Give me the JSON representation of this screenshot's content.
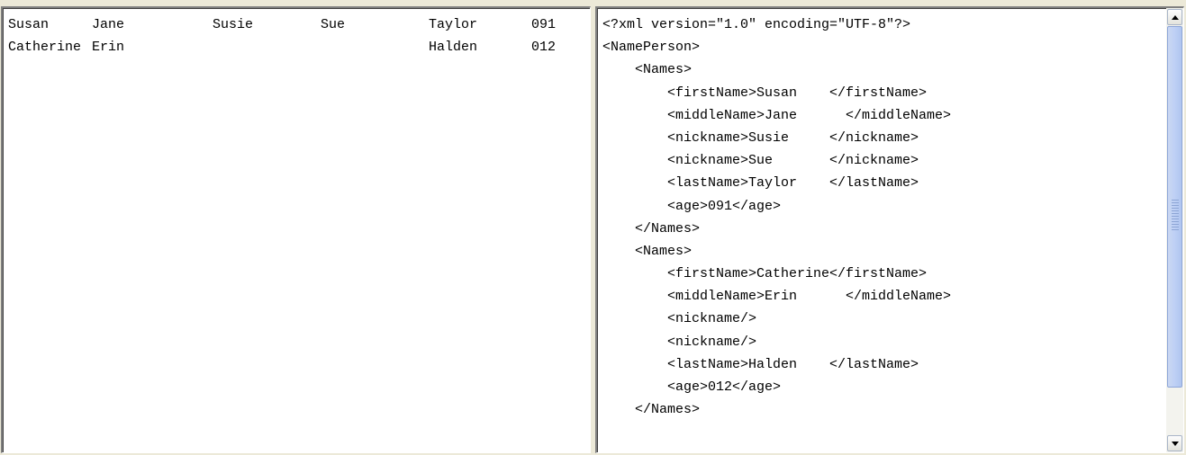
{
  "records": [
    {
      "firstName": "Susan",
      "middleName": "Jane",
      "nickname1": "Susie",
      "nickname2": "Sue",
      "lastName": "Taylor",
      "age": "091"
    },
    {
      "firstName": "Catherine",
      "middleName": "Erin",
      "nickname1": "",
      "nickname2": "",
      "lastName": "Halden",
      "age": "012"
    }
  ],
  "xml_lines": [
    "<?xml version=\"1.0\" encoding=\"UTF-8\"?>",
    "<NamePerson>",
    "    <Names>",
    "        <firstName>Susan    </firstName>",
    "        <middleName>Jane      </middleName>",
    "        <nickname>Susie     </nickname>",
    "        <nickname>Sue       </nickname>",
    "        <lastName>Taylor    </lastName>",
    "        <age>091</age>",
    "    </Names>",
    "    <Names>",
    "        <firstName>Catherine</firstName>",
    "        <middleName>Erin      </middleName>",
    "        <nickname/>",
    "        <nickname/>",
    "        <lastName>Halden    </lastName>",
    "        <age>012</age>",
    "    </Names>"
  ],
  "scrollbar": {
    "up_icon": "scroll-up-arrow",
    "down_icon": "scroll-down-arrow",
    "thumb_color": "#bed0f5",
    "track_color": "#f3f3ee"
  },
  "colors": {
    "window_bg": "#ece9d8",
    "pane_bg": "#ffffff"
  }
}
